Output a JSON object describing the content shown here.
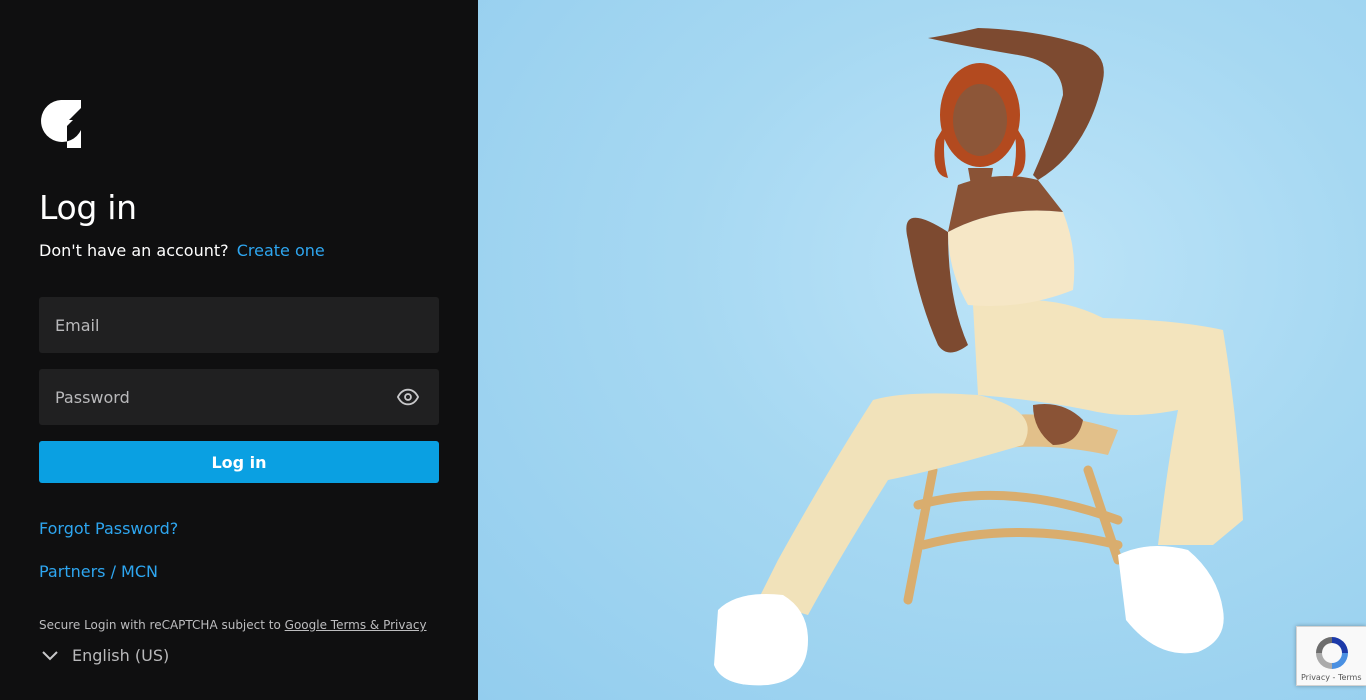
{
  "login": {
    "title": "Log in",
    "no_account_text": "Don't have an account?",
    "create_link": "Create one",
    "email_placeholder": "Email",
    "password_placeholder": "Password",
    "submit_label": "Log in",
    "forgot_link": "Forgot Password?",
    "partners_link": "Partners / MCN",
    "recaptcha_prefix": "Secure Login with reCAPTCHA subject to ",
    "recaptcha_terms_link": "Google Terms & Privacy",
    "language": "English (US)"
  },
  "recaptcha_badge": {
    "terms": "Privacy - Terms"
  },
  "icons": {
    "logo": "brand-logo-icon",
    "password_toggle": "eye-icon",
    "language_toggle": "chevron-down-icon",
    "recaptcha": "recaptcha-icon"
  },
  "colors": {
    "left_bg": "#0f0f10",
    "field_bg": "#202021",
    "accent": "#0aa0e2",
    "link": "#2ea6f0",
    "photo_bg": "#a6d8f2"
  }
}
